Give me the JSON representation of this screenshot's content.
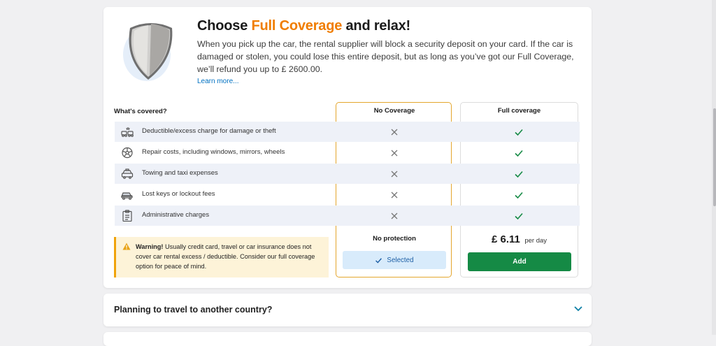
{
  "coverage": {
    "title_prefix": "Choose ",
    "title_accent": "Full Coverage",
    "title_suffix": " and relax!",
    "description": "When you pick up the car, the rental supplier will block a security deposit on your card. If the car is damaged or stolen, you could lose this entire deposit, but as long as you’ve got our Full Coverage, we’ll refund you up to £ 2600.00.",
    "learn_more": "Learn more...",
    "whats_covered": "What's covered?",
    "rows": [
      {
        "label": "Deductible/excess charge for damage or theft",
        "icon": "car-crash-icon"
      },
      {
        "label": "Repair costs, including windows, mirrors, wheels",
        "icon": "wheel-icon"
      },
      {
        "label": "Towing and taxi expenses",
        "icon": "taxi-icon"
      },
      {
        "label": "Lost keys or lockout fees",
        "icon": "car-key-icon"
      },
      {
        "label": "Administrative charges",
        "icon": "clipboard-icon"
      }
    ],
    "no_coverage": {
      "heading": "No Coverage",
      "marks": [
        "x",
        "x",
        "x",
        "x",
        "x"
      ],
      "summary": "No protection",
      "button": "Selected"
    },
    "full_coverage": {
      "heading": "Full coverage",
      "marks": [
        "check",
        "check",
        "check",
        "check",
        "check"
      ],
      "price": "£ 6.11",
      "per": "per day",
      "button": "Add"
    },
    "warning": {
      "title": "Warning!",
      "text": " Usually credit card, travel or car insurance does not cover car rental excess / deductible. Consider our full coverage option for peace of mind."
    },
    "colors": {
      "accent": "#f07d00",
      "selected_border": "#e4a62d",
      "add_button": "#158a45",
      "check": "#158a45",
      "link": "#0071c2"
    }
  },
  "travel": {
    "title": "Planning to travel to another country?"
  }
}
